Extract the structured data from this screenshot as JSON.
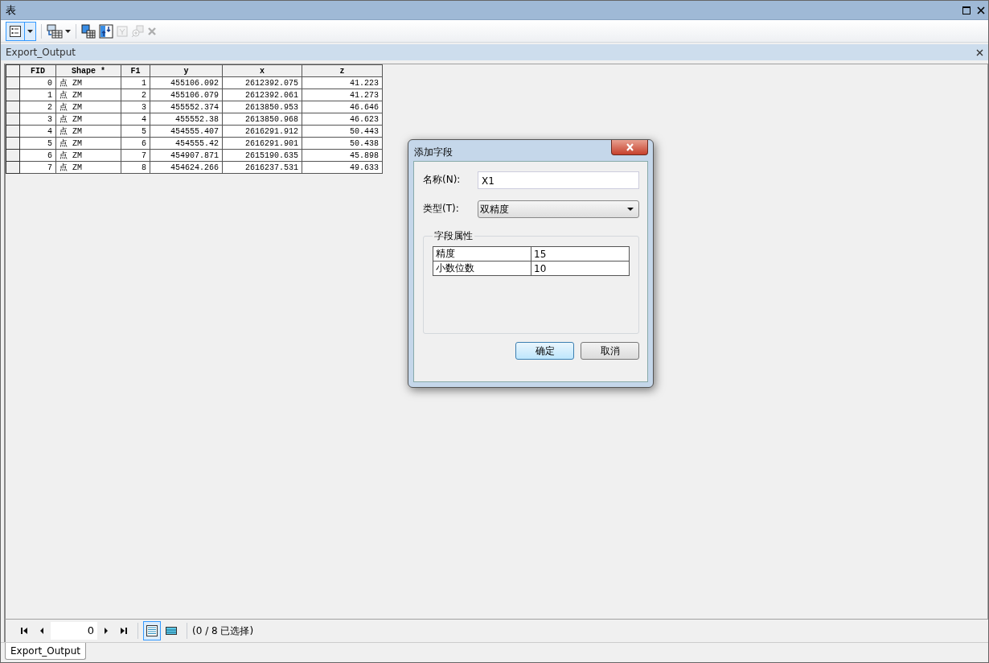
{
  "window": {
    "title": "表"
  },
  "toolbar": {
    "options_selected": true
  },
  "table_tab": {
    "title": "Export_Output"
  },
  "table": {
    "columns": [
      "FID",
      "Shape *",
      "F1",
      "y",
      "x",
      "z"
    ],
    "rows": [
      [
        "0",
        "点 ZM",
        "1",
        "455106.092",
        "2612392.075",
        "41.223"
      ],
      [
        "1",
        "点 ZM",
        "2",
        "455106.079",
        "2612392.061",
        "41.273"
      ],
      [
        "2",
        "点 ZM",
        "3",
        "455552.374",
        "2613850.953",
        "46.646"
      ],
      [
        "3",
        "点 ZM",
        "4",
        "455552.38",
        "2613850.968",
        "46.623"
      ],
      [
        "4",
        "点 ZM",
        "5",
        "454555.407",
        "2616291.912",
        "50.443"
      ],
      [
        "5",
        "点 ZM",
        "6",
        "454555.42",
        "2616291.901",
        "50.438"
      ],
      [
        "6",
        "点 ZM",
        "7",
        "454907.871",
        "2615190.635",
        "45.898"
      ],
      [
        "7",
        "点 ZM",
        "8",
        "454624.266",
        "2616237.531",
        "49.633"
      ]
    ]
  },
  "navigator": {
    "record": "0",
    "views": [
      {
        "kind": "all",
        "selected": true
      },
      {
        "kind": "selected",
        "selected": false
      }
    ],
    "selection_text": "(0 / 8 已选择)"
  },
  "bottom_tabs": [
    {
      "label": "Export_Output",
      "selected": true
    }
  ],
  "dialog": {
    "title": "添加字段",
    "name_label": "名称(N):",
    "name_value": "X1",
    "type_label": "类型(T):",
    "type_value": "双精度",
    "group_title": "字段属性",
    "properties": [
      {
        "name": "精度",
        "value": "15"
      },
      {
        "name": "小数位数",
        "value": "10"
      }
    ],
    "buttons": [
      {
        "label": "确定",
        "kind": "default"
      },
      {
        "label": "取消",
        "kind": "normal"
      }
    ]
  }
}
